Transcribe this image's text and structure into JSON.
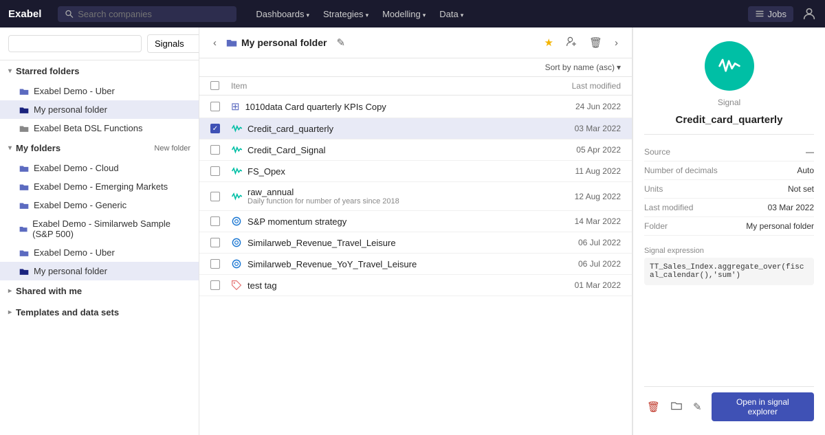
{
  "app": {
    "logo": "Exabel",
    "search_placeholder": "Search companies",
    "nav_items": [
      {
        "label": "Dashboards",
        "has_arrow": true
      },
      {
        "label": "Strategies",
        "has_arrow": true
      },
      {
        "label": "Modelling",
        "has_arrow": true
      },
      {
        "label": "Data",
        "has_arrow": true
      }
    ],
    "jobs_label": "Jobs",
    "user_icon": "👤"
  },
  "sidebar": {
    "filter_placeholder": "",
    "filter_select": "Signals",
    "starred_section": {
      "label": "Starred folders",
      "items": [
        {
          "label": "Exabel Demo - Uber",
          "icon": "folder"
        },
        {
          "label": "My personal folder",
          "icon": "folder"
        },
        {
          "label": "Exabel Beta DSL Functions",
          "icon": "folder"
        }
      ]
    },
    "my_folders_section": {
      "label": "My folders",
      "new_folder_label": "New folder",
      "items": [
        {
          "label": "Exabel Demo - Cloud",
          "icon": "folder"
        },
        {
          "label": "Exabel Demo - Emerging Markets",
          "icon": "folder"
        },
        {
          "label": "Exabel Demo - Generic",
          "icon": "folder"
        },
        {
          "label": "Exabel Demo - Similarweb Sample (S&P 500)",
          "icon": "folder"
        },
        {
          "label": "Exabel Demo - Uber",
          "icon": "folder"
        },
        {
          "label": "My personal folder",
          "icon": "folder",
          "active": true
        }
      ]
    },
    "shared_section": {
      "label": "Shared with me"
    },
    "templates_section": {
      "label": "Templates and data sets"
    }
  },
  "main": {
    "breadcrumb_folder": "My personal folder",
    "folder_icon": "📁",
    "sort_label": "Sort by name (asc)",
    "table": {
      "col_item": "Item",
      "col_modified": "Last modified",
      "rows": [
        {
          "id": 1,
          "type": "table",
          "name": "1010data Card quarterly KPIs Copy",
          "modified": "24 Jun 2022",
          "selected": false,
          "icon": "⊞"
        },
        {
          "id": 2,
          "type": "signal",
          "name": "Credit_card_quarterly",
          "modified": "03 Mar 2022",
          "selected": true,
          "icon": "〜"
        },
        {
          "id": 3,
          "type": "signal",
          "name": "Credit_Card_Signal",
          "modified": "05 Apr 2022",
          "selected": false,
          "icon": "〜"
        },
        {
          "id": 4,
          "type": "signal",
          "name": "FS_Opex",
          "modified": "11 Aug 2022",
          "selected": false,
          "icon": "〜"
        },
        {
          "id": 5,
          "type": "signal",
          "name": "raw_annual",
          "sub": "Daily function for number of years since 2018",
          "modified": "12 Aug 2022",
          "selected": false,
          "icon": "〜"
        },
        {
          "id": 6,
          "type": "strategy",
          "name": "S&P momentum strategy",
          "modified": "14 Mar 2022",
          "selected": false,
          "icon": "⊙"
        },
        {
          "id": 7,
          "type": "strategy",
          "name": "Similarweb_Revenue_Travel_Leisure",
          "modified": "06 Jul 2022",
          "selected": false,
          "icon": "⊙"
        },
        {
          "id": 8,
          "type": "strategy",
          "name": "Similarweb_Revenue_YoY_Travel_Leisure",
          "modified": "06 Jul 2022",
          "selected": false,
          "icon": "⊙"
        },
        {
          "id": 9,
          "type": "tag",
          "name": "test tag",
          "modified": "01 Mar 2022",
          "selected": false,
          "icon": "◇"
        }
      ]
    }
  },
  "right_panel": {
    "signal_type_label": "Signal",
    "signal_name": "Credit_card_quarterly",
    "source_label": "Source",
    "source_value": "—",
    "decimals_label": "Number of decimals",
    "decimals_value": "Auto",
    "units_label": "Units",
    "units_value": "Not set",
    "last_modified_label": "Last modified",
    "last_modified_value": "03 Mar 2022",
    "folder_label": "Folder",
    "folder_value": "My personal folder",
    "expression_label": "Signal expression",
    "expression_code": "TT_Sales_Index.aggregate_over(fiscal_calendar(),\\'sum\\')",
    "open_btn_label": "Open in signal explorer"
  }
}
